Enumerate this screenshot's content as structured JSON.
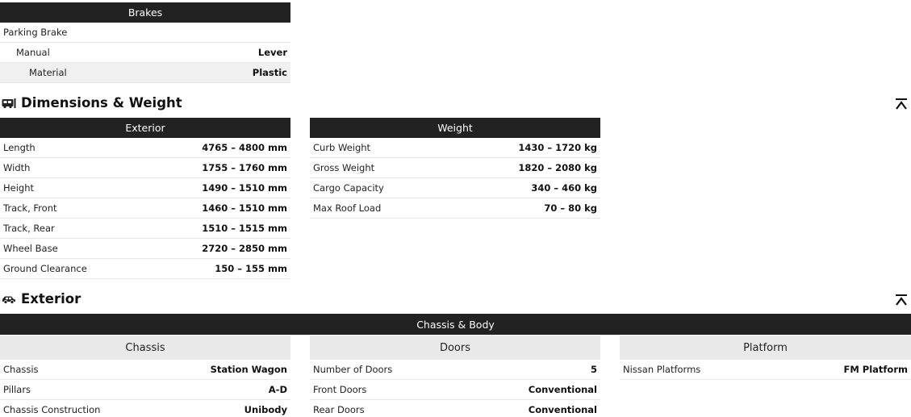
{
  "brakes": {
    "header": "Brakes",
    "rows": [
      {
        "key": "Parking Brake",
        "value": ""
      },
      {
        "key": "Manual",
        "value": "Lever"
      },
      {
        "key": "Material",
        "value": "Plastic"
      }
    ]
  },
  "dimensions": {
    "title": "Dimensions & Weight",
    "exterior": {
      "header": "Exterior",
      "rows": [
        {
          "key": "Length",
          "value": "4765 – 4800 mm"
        },
        {
          "key": "Width",
          "value": "1755 – 1760 mm"
        },
        {
          "key": "Height",
          "value": "1490 – 1510 mm"
        },
        {
          "key": "Track, Front",
          "value": "1460 – 1510 mm"
        },
        {
          "key": "Track, Rear",
          "value": "1510 – 1515 mm"
        },
        {
          "key": "Wheel Base",
          "value": "2720 – 2850 mm"
        },
        {
          "key": "Ground Clearance",
          "value": "150 – 155 mm"
        }
      ]
    },
    "weight": {
      "header": "Weight",
      "rows": [
        {
          "key": "Curb Weight",
          "value": "1430 – 1720 kg"
        },
        {
          "key": "Gross Weight",
          "value": "1820 – 2080 kg"
        },
        {
          "key": "Cargo Capacity",
          "value": "340 – 460 kg"
        },
        {
          "key": "Max Roof Load",
          "value": "70 – 80 kg"
        }
      ]
    }
  },
  "exterior": {
    "title": "Exterior",
    "band_header": "Chassis & Body",
    "chassis": {
      "header": "Chassis",
      "rows": [
        {
          "key": "Chassis",
          "value": "Station Wagon"
        },
        {
          "key": "Pillars",
          "value": "A-D"
        },
        {
          "key": "Chassis Construction",
          "value": "Unibody"
        }
      ]
    },
    "doors": {
      "header": "Doors",
      "rows": [
        {
          "key": "Number of Doors",
          "value": "5"
        },
        {
          "key": "Front Doors",
          "value": "Conventional"
        },
        {
          "key": "Rear Doors",
          "value": "Conventional"
        }
      ]
    },
    "platform": {
      "header": "Platform",
      "rows": [
        {
          "key": "Nissan Platforms",
          "value": "FM Platform"
        }
      ]
    }
  },
  "icons": {
    "dimensions": "car-side-box-icon",
    "exterior": "car-icon",
    "collapse": "chevron-up-bar-icon"
  }
}
